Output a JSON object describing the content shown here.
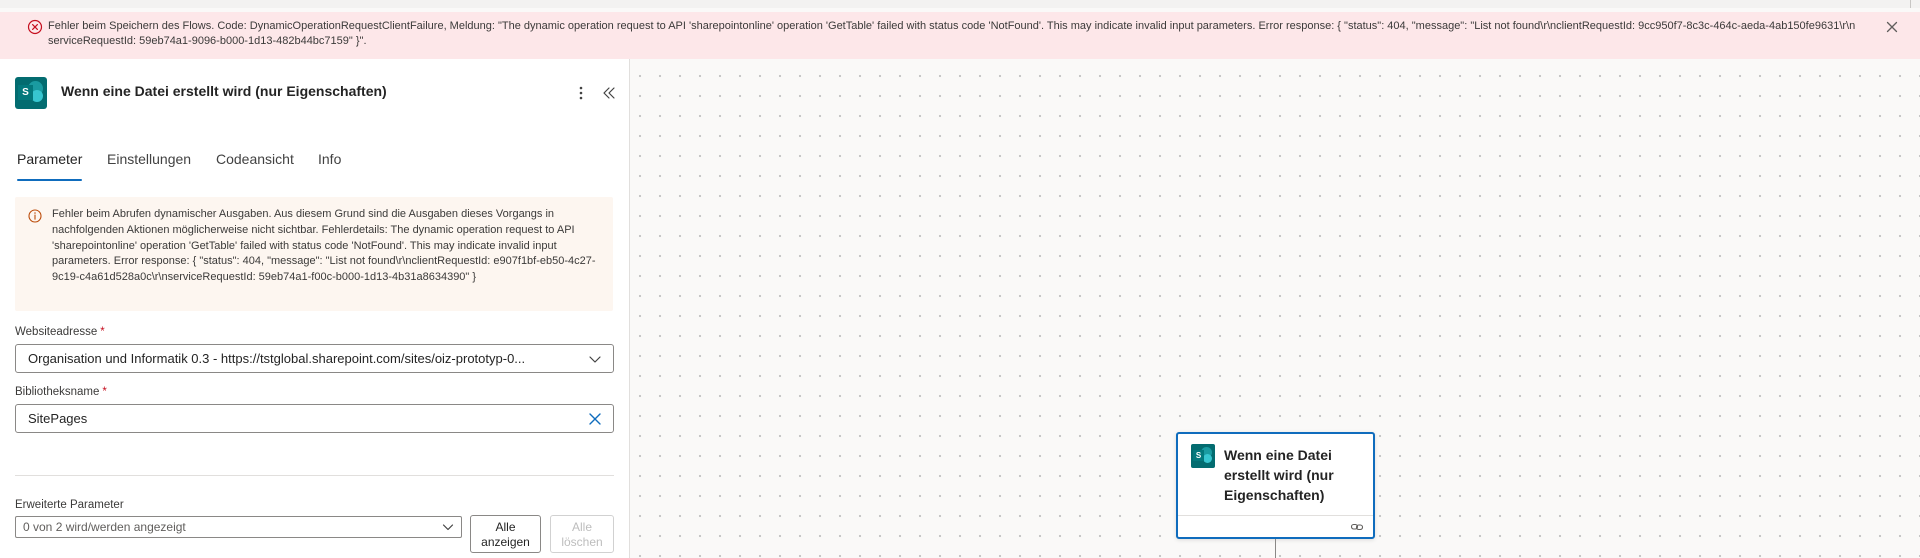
{
  "error_banner": {
    "message": "Fehler beim Speichern des Flows. Code: DynamicOperationRequestClientFailure, Meldung: \"The dynamic operation request to API 'sharepointonline' operation 'GetTable' failed with status code 'NotFound'. This may indicate invalid input parameters. Error response: { \"status\": 404, \"message\": \"List not found\\r\\nclientRequestId: 9cc950f7-8c3c-464c-aeda-4ab150fe9631\\r\\nserviceRequestId: 59eb74a1-9096-b000-1d13-482b44bc7159\" }\".",
    "icon": "error-circle-icon",
    "close_icon": "close-icon"
  },
  "panel": {
    "title": "Wenn eine Datei erstellt wird (nur Eigenschaften)",
    "logo_letter": "S",
    "more_icon": "more-vertical-icon",
    "collapse_icon": "chevron-double-left-icon",
    "tabs": [
      {
        "label": "Parameter",
        "active": true
      },
      {
        "label": "Einstellungen",
        "active": false
      },
      {
        "label": "Codeansicht",
        "active": false
      },
      {
        "label": "Info",
        "active": false
      }
    ],
    "warning": {
      "icon": "info-icon",
      "text": "Fehler beim Abrufen dynamischer Ausgaben. Aus diesem Grund sind die Ausgaben dieses Vorgangs in nachfolgenden Aktionen möglicherweise nicht sichtbar. Fehlerdetails: The dynamic operation request to API 'sharepointonline' operation 'GetTable' failed with status code 'NotFound'. This may indicate invalid input parameters. Error response: { \"status\": 404, \"message\": \"List not found\\r\\nclientRequestId: e907f1bf-eb50-4c27-9c19-c4a61d528a0c\\r\\nserviceRequestId: 59eb74a1-f00c-b000-1d13-4b31a8634390\" }"
    },
    "site_field": {
      "label": "Websiteadresse",
      "required_mark": "*",
      "value": "Organisation und Informatik 0.3 - https://tstglobal.sharepoint.com/sites/oiz-prototyp-0..."
    },
    "library_field": {
      "label": "Bibliotheksname",
      "required_mark": "*",
      "value": "SitePages"
    },
    "advanced": {
      "label": "Erweiterte Parameter",
      "select_value": "0 von 2 wird/werden angezeigt",
      "show_all_line1": "Alle",
      "show_all_line2": "anzeigen",
      "clear_all_line1": "Alle",
      "clear_all_line2": "löschen"
    }
  },
  "node": {
    "title": "Wenn eine Datei erstellt wird (nur Eigenschaften)",
    "logo_letter": "S",
    "link_icon": "link-icon"
  },
  "colors": {
    "accent": "#0f6cbd",
    "error_bg": "#fde7e9",
    "error_icon": "#c50f1f",
    "warning_bg": "#fdf6f0",
    "warning_icon": "#bc4b09",
    "sharepoint": "#036c70"
  }
}
